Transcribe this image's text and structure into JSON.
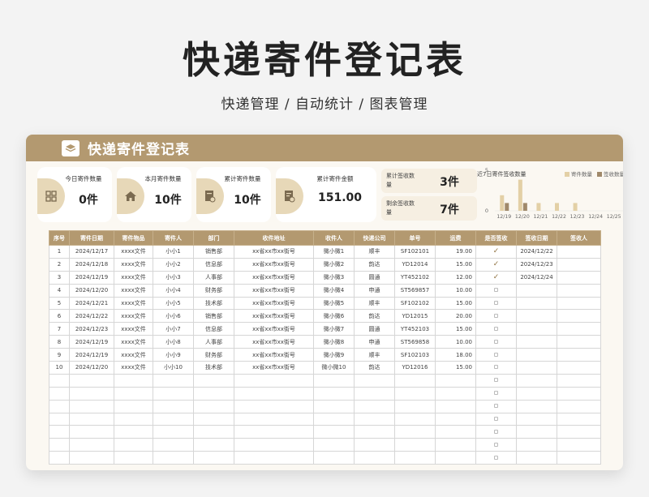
{
  "page": {
    "title": "快递寄件登记表",
    "subtitle": "快递管理 / 自动统计 / 图表管理"
  },
  "card": {
    "title": "快递寄件登记表",
    "stats": [
      {
        "label": "今日寄件数量",
        "value": "0件",
        "icon": "qr-grid-icon"
      },
      {
        "label": "本月寄件数量",
        "value": "10件",
        "icon": "home-icon"
      },
      {
        "label": "累计寄件数量",
        "value": "10件",
        "icon": "document-clock-icon"
      },
      {
        "label": "累计寄件金额",
        "value": "151.00",
        "icon": "document-money-icon"
      }
    ],
    "mini_stats": [
      {
        "label": "累计签收数量",
        "value": "3件"
      },
      {
        "label": "剩余签收数量",
        "value": "7件"
      }
    ]
  },
  "chart_data": {
    "type": "bar",
    "title": "近7日寄件签收数量",
    "categories": [
      "12/19",
      "12/20",
      "12/21",
      "12/22",
      "12/23",
      "12/24",
      "12/25"
    ],
    "series": [
      {
        "name": "寄件数量",
        "values": [
          2,
          4,
          1,
          1,
          1,
          0,
          0
        ],
        "color": "#e3d0a6"
      },
      {
        "name": "签收数量",
        "values": [
          1,
          1,
          0,
          0,
          0,
          0,
          0
        ],
        "color": "#a0896a"
      }
    ],
    "ylim": [
      0,
      5
    ],
    "yticks": [
      "0",
      "5"
    ],
    "legend": "top-right"
  },
  "colors": {
    "accent": "#b39970",
    "accent_light": "#e7d8b8"
  },
  "table": {
    "columns": [
      "序号",
      "寄件日期",
      "寄件物品",
      "寄件人",
      "部门",
      "收件地址",
      "收件人",
      "快递公司",
      "单号",
      "运费",
      "是否签收",
      "签收日期",
      "签收人"
    ],
    "rows": [
      [
        "1",
        "2024/12/17",
        "xxxx文件",
        "小小1",
        "销售部",
        "xx省xx市xx街号",
        "微小微1",
        "顺丰",
        "SF102101",
        "19.00",
        "check",
        "2024/12/22",
        ""
      ],
      [
        "2",
        "2024/12/18",
        "xxxx文件",
        "小小2",
        "信息部",
        "xx省xx市xx街号",
        "微小微2",
        "韵达",
        "YD12014",
        "15.00",
        "check",
        "2024/12/23",
        ""
      ],
      [
        "3",
        "2024/12/19",
        "xxxx文件",
        "小小3",
        "人事部",
        "xx省xx市xx街号",
        "微小微3",
        "圆通",
        "YT452102",
        "12.00",
        "check",
        "2024/12/24",
        ""
      ],
      [
        "4",
        "2024/12/20",
        "xxxx文件",
        "小小4",
        "财务部",
        "xx省xx市xx街号",
        "微小微4",
        "申通",
        "ST569857",
        "10.00",
        "box",
        "",
        ""
      ],
      [
        "5",
        "2024/12/21",
        "xxxx文件",
        "小小5",
        "技术部",
        "xx省xx市xx街号",
        "微小微5",
        "顺丰",
        "SF102102",
        "15.00",
        "box",
        "",
        ""
      ],
      [
        "6",
        "2024/12/22",
        "xxxx文件",
        "小小6",
        "销售部",
        "xx省xx市xx街号",
        "微小微6",
        "韵达",
        "YD12015",
        "20.00",
        "box",
        "",
        ""
      ],
      [
        "7",
        "2024/12/23",
        "xxxx文件",
        "小小7",
        "信息部",
        "xx省xx市xx街号",
        "微小微7",
        "圆通",
        "YT452103",
        "15.00",
        "box",
        "",
        ""
      ],
      [
        "8",
        "2024/12/19",
        "xxxx文件",
        "小小8",
        "人事部",
        "xx省xx市xx街号",
        "微小微8",
        "申通",
        "ST569858",
        "10.00",
        "box",
        "",
        ""
      ],
      [
        "9",
        "2024/12/19",
        "xxxx文件",
        "小小9",
        "财务部",
        "xx省xx市xx街号",
        "微小微9",
        "顺丰",
        "SF102103",
        "18.00",
        "box",
        "",
        ""
      ],
      [
        "10",
        "2024/12/20",
        "xxxx文件",
        "小小10",
        "技术部",
        "xx省xx市xx街号",
        "微小微10",
        "韵达",
        "YD12016",
        "15.00",
        "box",
        "",
        ""
      ],
      [
        "",
        "",
        "",
        "",
        "",
        "",
        "",
        "",
        "",
        "",
        "box",
        "",
        ""
      ],
      [
        "",
        "",
        "",
        "",
        "",
        "",
        "",
        "",
        "",
        "",
        "box",
        "",
        ""
      ],
      [
        "",
        "",
        "",
        "",
        "",
        "",
        "",
        "",
        "",
        "",
        "box",
        "",
        ""
      ],
      [
        "",
        "",
        "",
        "",
        "",
        "",
        "",
        "",
        "",
        "",
        "box",
        "",
        ""
      ],
      [
        "",
        "",
        "",
        "",
        "",
        "",
        "",
        "",
        "",
        "",
        "box",
        "",
        ""
      ],
      [
        "",
        "",
        "",
        "",
        "",
        "",
        "",
        "",
        "",
        "",
        "box",
        "",
        ""
      ],
      [
        "",
        "",
        "",
        "",
        "",
        "",
        "",
        "",
        "",
        "",
        "box",
        "",
        ""
      ]
    ]
  }
}
